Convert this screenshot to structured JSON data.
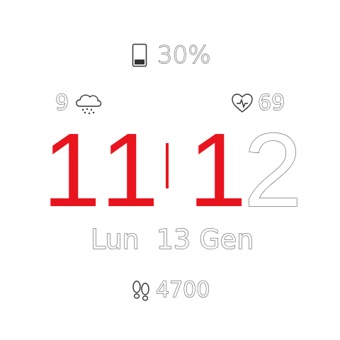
{
  "battery": {
    "percent_text": "30%",
    "level": 0.3,
    "icon": "battery-icon"
  },
  "weather": {
    "temperature": "9",
    "icon": "cloud-snow-icon"
  },
  "heart": {
    "rate": "69",
    "icon": "heart-pulse-icon"
  },
  "time": {
    "hour_tens": "1",
    "hour_ones": "1",
    "minute_tens": "1",
    "minute_ones": "2"
  },
  "date": {
    "text": "Lun  13 Gen"
  },
  "steps": {
    "count": "4700",
    "icon": "footsteps-icon"
  },
  "colors": {
    "accent": "#e8141e",
    "background": "#ffffff",
    "outline": "#333333"
  }
}
